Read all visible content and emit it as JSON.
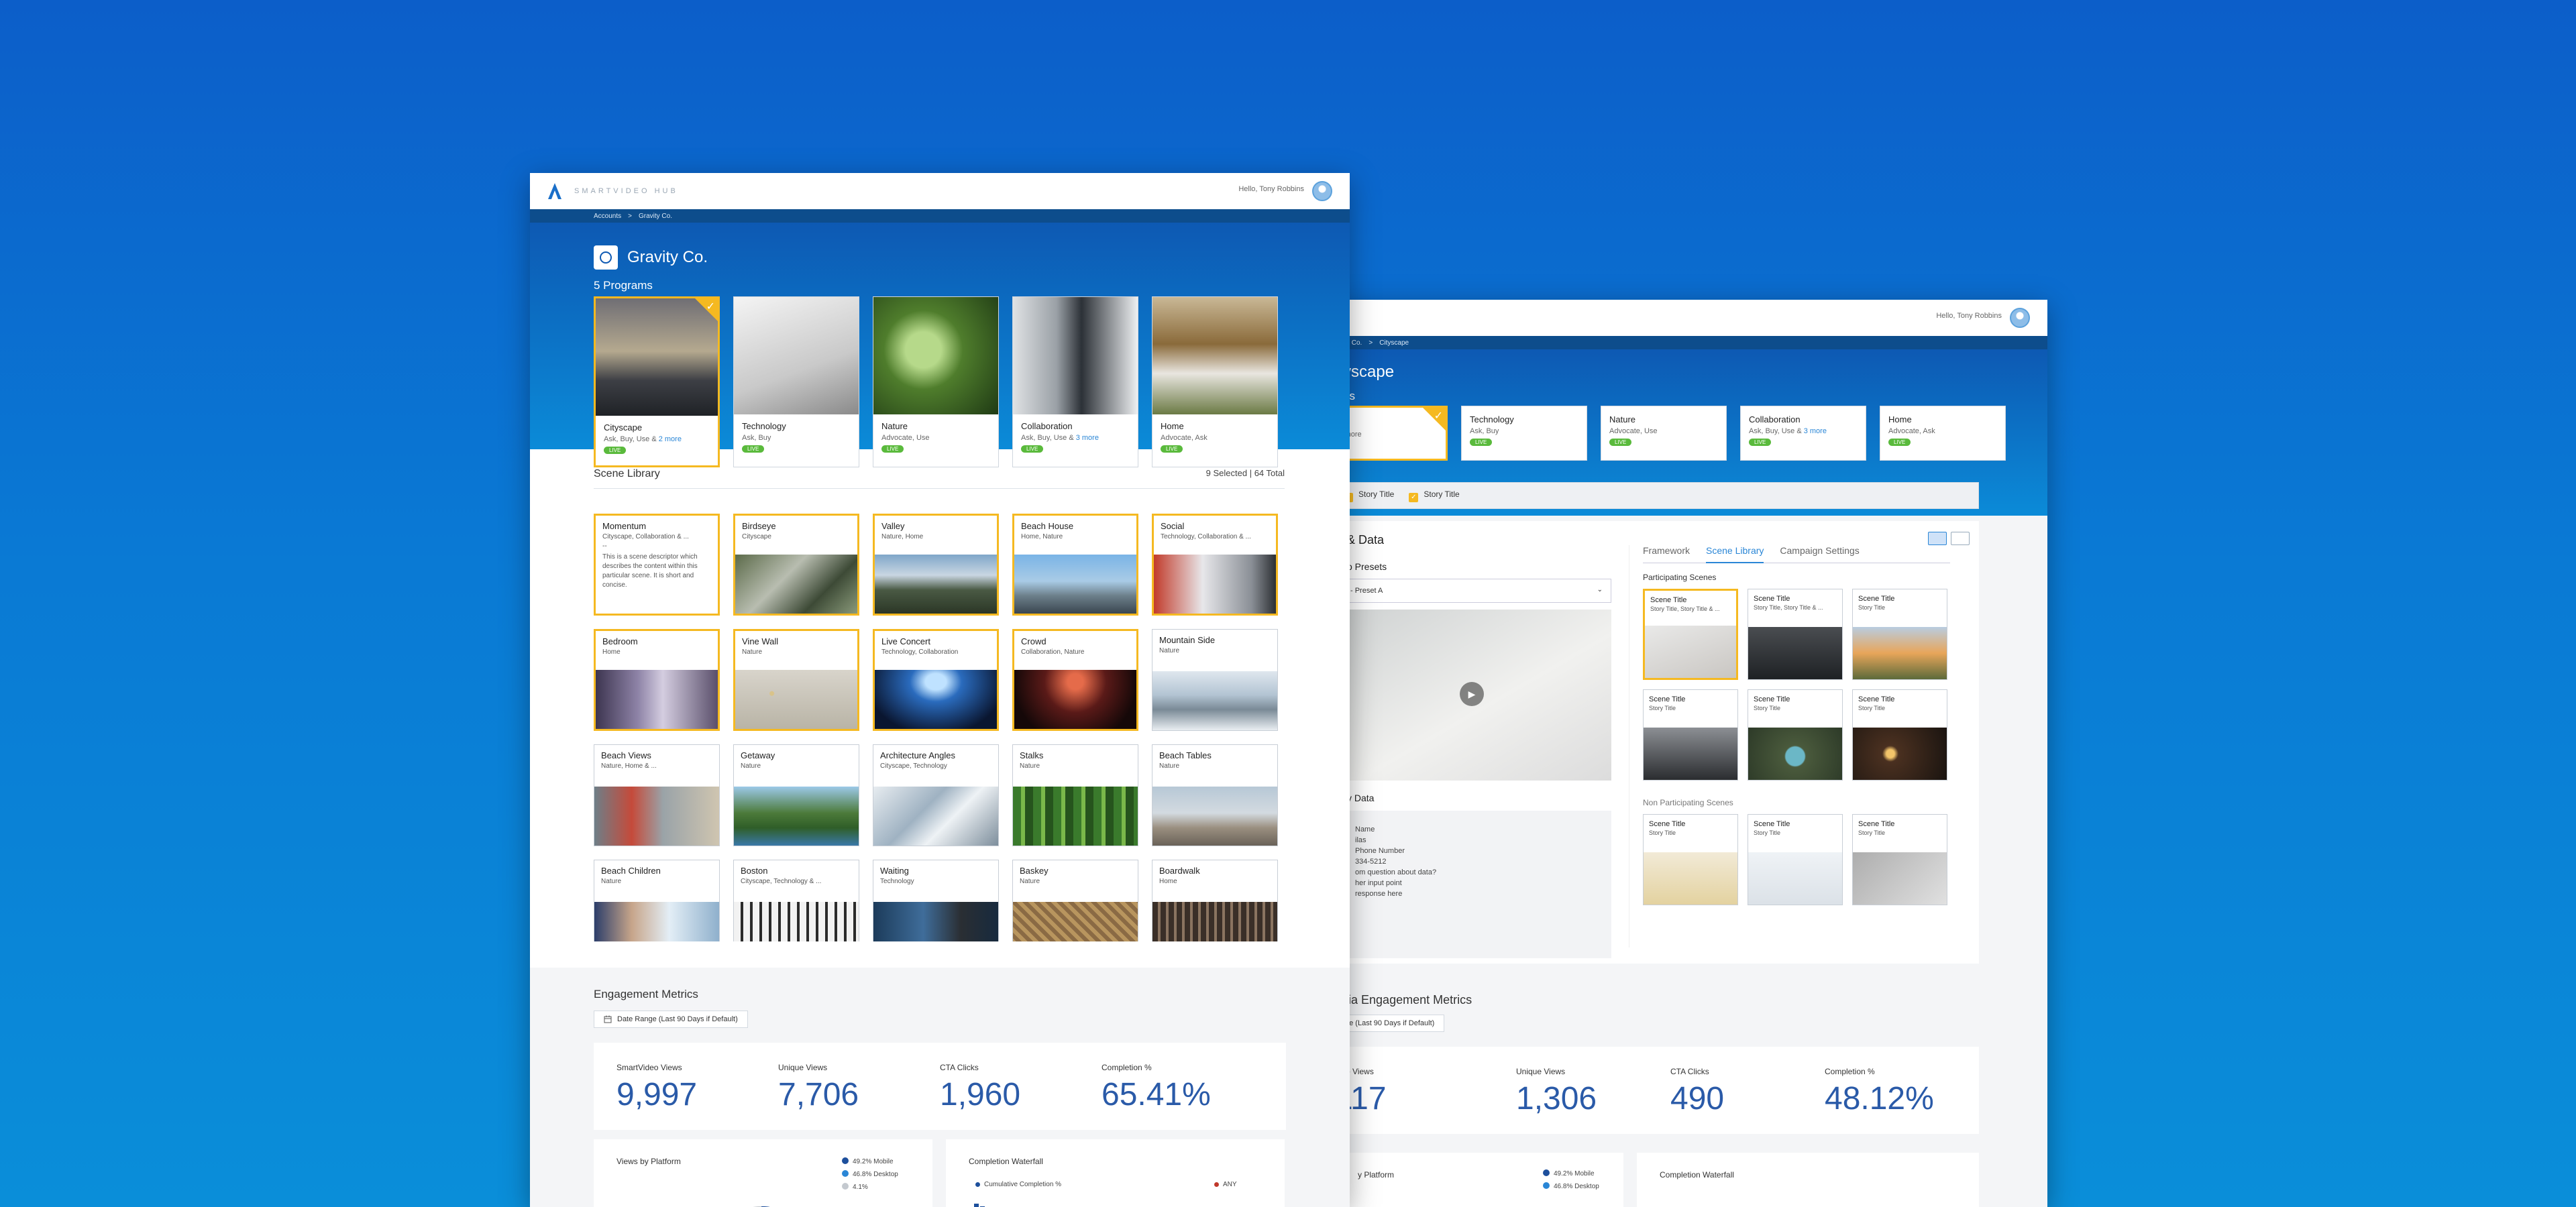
{
  "colors": {
    "accent": "#2a86d6",
    "selected": "#f5b921",
    "live": "#5aba3c",
    "metric": "#2a5aa8"
  },
  "main": {
    "brand": "SMARTVIDEO HUB",
    "greeting": "Hello, Tony Robbins",
    "breadcrumb": [
      "Accounts",
      ">",
      "Gravity Co."
    ],
    "account": "Gravity Co.",
    "programs_title": "5 Programs",
    "programs": [
      {
        "title": "Cityscape",
        "sub": "Ask, Buy, Use &",
        "more": "2 more",
        "status": "LIVE",
        "selected": true
      },
      {
        "title": "Technology",
        "sub": "Ask, Buy",
        "more": "",
        "status": "LIVE",
        "selected": false
      },
      {
        "title": "Nature",
        "sub": "Advocate, Use",
        "more": "",
        "status": "LIVE",
        "selected": false
      },
      {
        "title": "Collaboration",
        "sub": "Ask, Buy, Use &",
        "more": "3 more",
        "status": "LIVE",
        "selected": false
      },
      {
        "title": "Home",
        "sub": "Advocate, Ask",
        "more": "",
        "status": "LIVE",
        "selected": false
      }
    ],
    "scene_library": {
      "title": "Scene Library",
      "count": "9 Selected  |  64 Total",
      "scenes": [
        {
          "title": "Momentum",
          "sub": "Cityscape, Collaboration & ...",
          "desc": "This is a scene descriptor which describes the content within this particular scene. It is short and concise.",
          "selected": true
        },
        {
          "title": "Birdseye",
          "sub": "Cityscape",
          "selected": true
        },
        {
          "title": "Valley",
          "sub": "Nature, Home",
          "selected": true
        },
        {
          "title": "Beach House",
          "sub": "Home, Nature",
          "selected": true
        },
        {
          "title": "Social",
          "sub": "Technology, Collaboration & ...",
          "selected": true
        },
        {
          "title": "Bedroom",
          "sub": "Home",
          "selected": true
        },
        {
          "title": "Vine Wall",
          "sub": "Nature",
          "selected": true
        },
        {
          "title": "Live Concert",
          "sub": "Technology, Collaboration",
          "selected": true
        },
        {
          "title": "Crowd",
          "sub": "Collaboration, Nature",
          "selected": true
        },
        {
          "title": "Mountain Side",
          "sub": "Nature",
          "selected": false
        },
        {
          "title": "Beach Views",
          "sub": "Nature, Home & ...",
          "selected": false
        },
        {
          "title": "Getaway",
          "sub": "Nature",
          "selected": false
        },
        {
          "title": "Architecture Angles",
          "sub": "Cityscape, Technology",
          "selected": false
        },
        {
          "title": "Stalks",
          "sub": "Nature",
          "selected": false
        },
        {
          "title": "Beach Tables",
          "sub": "Nature",
          "selected": false
        },
        {
          "title": "Beach Children",
          "sub": "Nature",
          "selected": false
        },
        {
          "title": "Boston",
          "sub": "Cityscape, Technology & ...",
          "selected": false
        },
        {
          "title": "Waiting",
          "sub": "Technology",
          "selected": false
        },
        {
          "title": "Baskey",
          "sub": "Nature",
          "selected": false
        },
        {
          "title": "Boardwalk",
          "sub": "Home",
          "selected": false
        }
      ]
    },
    "engagement": {
      "title": "Engagement Metrics",
      "date_range": "Date Range (Last 90 Days if Default)",
      "metrics": [
        {
          "label": "SmartVideo Views",
          "value": "9,997"
        },
        {
          "label": "Unique Views",
          "value": "7,706"
        },
        {
          "label": "CTA Clicks",
          "value": "1,960"
        },
        {
          "label": "Completion %",
          "value": "65.41%"
        }
      ],
      "platform_title": "Views by Platform",
      "platform_legend": [
        "49.2% Mobile",
        "46.8% Desktop",
        "4.1%"
      ],
      "waterfall_title": "Completion Waterfall",
      "waterfall_legend": [
        "Cumulative Completion %",
        "ANY"
      ]
    }
  },
  "secondary": {
    "greeting": "Hello, Tony Robbins",
    "breadcrumb": [
      "ity Co.",
      ">",
      "Cityscape"
    ],
    "program_title": "yscape",
    "programs_trunc": "ns",
    "programs": [
      {
        "title": "",
        "sub": "& 2 more",
        "status": "",
        "selected": true
      },
      {
        "title": "Technology",
        "sub": "Ask, Buy",
        "status": "LIVE"
      },
      {
        "title": "Nature",
        "sub": "Advocate, Use",
        "status": "LIVE"
      },
      {
        "title": "Collaboration",
        "sub": "Ask, Buy, Use &",
        "more": "3 more",
        "status": "LIVE"
      },
      {
        "title": "Home",
        "sub": "Advocate, Ask",
        "status": "LIVE"
      }
    ],
    "story_titles": [
      "Story Title",
      "Story Title"
    ],
    "content_title": "& Data",
    "presets_label": "o Presets",
    "preset_value": "- Preset A",
    "data_label": "y Data",
    "form_lines": [
      "Name",
      "ilas",
      "",
      "Phone Number",
      "334-5212",
      "",
      "om question about data?",
      "",
      "her input point",
      "response here"
    ],
    "tabs": [
      "Framework",
      "Scene Library",
      "Campaign Settings"
    ],
    "participating_label": "Participating Scenes",
    "participating": [
      {
        "title": "Scene Title",
        "sub": "Story Title, Story Title & ...",
        "selected": true
      },
      {
        "title": "Scene Title",
        "sub": "Story Title, Story Title & ..."
      },
      {
        "title": "Scene Title",
        "sub": "Story Title"
      },
      {
        "title": "Scene Title",
        "sub": "Story Title"
      },
      {
        "title": "Scene Title",
        "sub": "Story Title"
      },
      {
        "title": "Scene Title",
        "sub": "Story Title"
      }
    ],
    "non_participating_label": "Non Participating Scenes",
    "non_participating": [
      {
        "title": "Scene Title",
        "sub": "Story Title"
      },
      {
        "title": "Scene Title",
        "sub": "Story Title"
      },
      {
        "title": "Scene Title",
        "sub": "Story Title"
      }
    ],
    "engagement": {
      "title": "edia Engagement Metrics",
      "date_range": "ge (Last 90 Days if Default)",
      "metrics": [
        {
          "label": "ideo Views",
          "value": "117"
        },
        {
          "label": "Unique Views",
          "value": "1,306"
        },
        {
          "label": "CTA Clicks",
          "value": "490"
        },
        {
          "label": "Completion %",
          "value": "48.12%"
        }
      ],
      "platform_title": "y Platform",
      "platform_legend": [
        "49.2% Mobile",
        "46.8% Desktop"
      ],
      "waterfall_title": "Completion Waterfall"
    }
  }
}
